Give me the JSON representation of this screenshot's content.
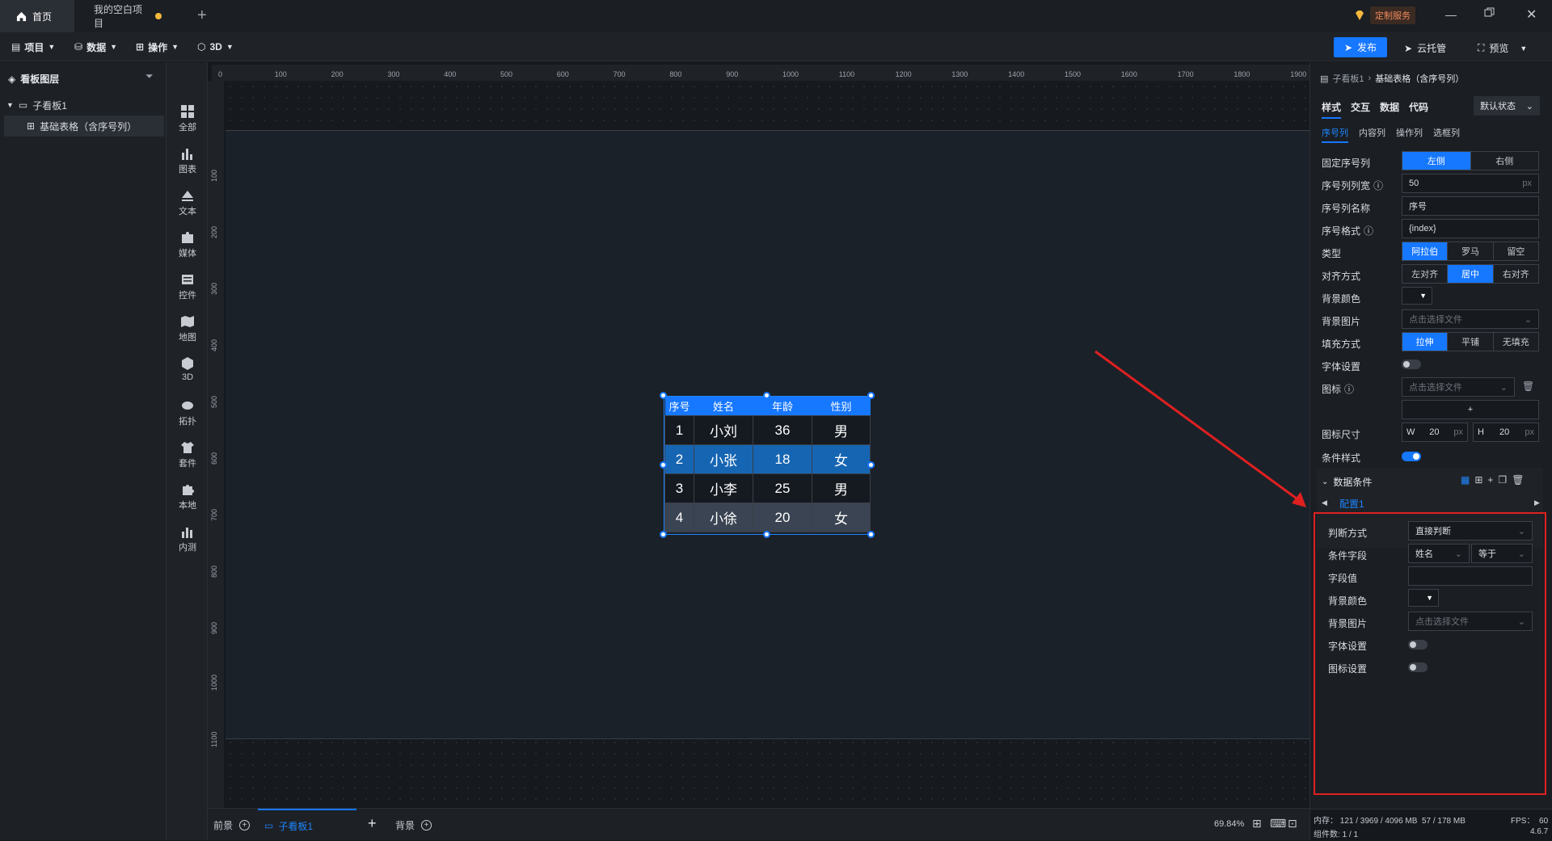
{
  "tabs": [
    {
      "label": "首页"
    },
    {
      "label": "我的空白项目"
    }
  ],
  "service_label": "定制服务",
  "menu": {
    "project": "项目",
    "data": "数据",
    "operate": "操作",
    "three_d": "3D"
  },
  "actions": {
    "publish": "发布",
    "cloud": "云托管",
    "preview": "预览"
  },
  "layers": {
    "title": "看板图层",
    "board": "子看板1",
    "item": "基础表格（含序号列）"
  },
  "components": [
    "全部",
    "图表",
    "文本",
    "媒体",
    "控件",
    "地图",
    "3D",
    "拓扑",
    "套件",
    "本地",
    "内测"
  ],
  "ruler": {
    "h": [
      "0",
      "100",
      "200",
      "300",
      "400",
      "500",
      "600",
      "700",
      "800",
      "900",
      "1000",
      "1100",
      "1200",
      "1300",
      "1400",
      "1500",
      "1600",
      "1700",
      "1800",
      "1900"
    ],
    "v": [
      "100",
      "200",
      "300",
      "400",
      "500",
      "600",
      "700",
      "800",
      "900",
      "1000",
      "1100"
    ]
  },
  "table": {
    "headers": [
      "序号",
      "姓名",
      "年龄",
      "性别"
    ],
    "rows": [
      [
        "1",
        "小刘",
        "36",
        "男"
      ],
      [
        "2",
        "小张",
        "18",
        "女"
      ],
      [
        "3",
        "小李",
        "25",
        "男"
      ],
      [
        "4",
        "小徐",
        "20",
        "女"
      ]
    ]
  },
  "bottom": {
    "front": "前景",
    "board": "子看板1",
    "background": "背景",
    "zoom": "69.84%"
  },
  "panel": {
    "breadcrumb_parent": "子看板1",
    "breadcrumb_current": "基础表格（含序号列）",
    "main_tabs": [
      "样式",
      "交互",
      "数据",
      "代码"
    ],
    "state": "默认状态",
    "sub_tabs": [
      "序号列",
      "内容列",
      "操作列",
      "选框列"
    ],
    "fix_label": "固定序号列",
    "fix_opts": [
      "左侧",
      "右侧"
    ],
    "width_label": "序号列列宽",
    "width_val": "50",
    "px": "px",
    "name_label": "序号列名称",
    "name_val": "序号",
    "format_label": "序号格式",
    "format_val": "{index}",
    "type_label": "类型",
    "type_opts": [
      "阿拉伯",
      "罗马",
      "留空"
    ],
    "align_label": "对齐方式",
    "align_opts": [
      "左对齐",
      "居中",
      "右对齐"
    ],
    "bgcolor_label": "背景颜色",
    "bgimg_label": "背景图片",
    "choose_file": "点击选择文件",
    "fill_label": "填充方式",
    "fill_opts": [
      "拉伸",
      "平铺",
      "无填充"
    ],
    "font_label": "字体设置",
    "icon_label": "图标",
    "add": "+",
    "size_label": "图标尺寸",
    "w": "W",
    "h": "H",
    "w_val": "20",
    "h_val": "20",
    "cond_label": "条件样式",
    "data_cond": "数据条件",
    "config": "配置1",
    "judge_label": "判断方式",
    "judge_val": "直接判断",
    "field_label": "条件字段",
    "field_val": "姓名",
    "op_val": "等于",
    "value_label": "字段值",
    "c_bgcolor_label": "背景颜色",
    "c_bgimg_label": "背景图片",
    "c_font_label": "字体设置",
    "c_icon_label": "图标设置"
  },
  "status": {
    "memory": "内存： 121 / 3969 / 4096 MB  57 / 178 MB",
    "fps": "FPS：  60",
    "count": "组件数: 1 / 1",
    "version": "4.6.7"
  },
  "colors": {
    "accent": "#1677ff",
    "highlight": "#e02020"
  }
}
